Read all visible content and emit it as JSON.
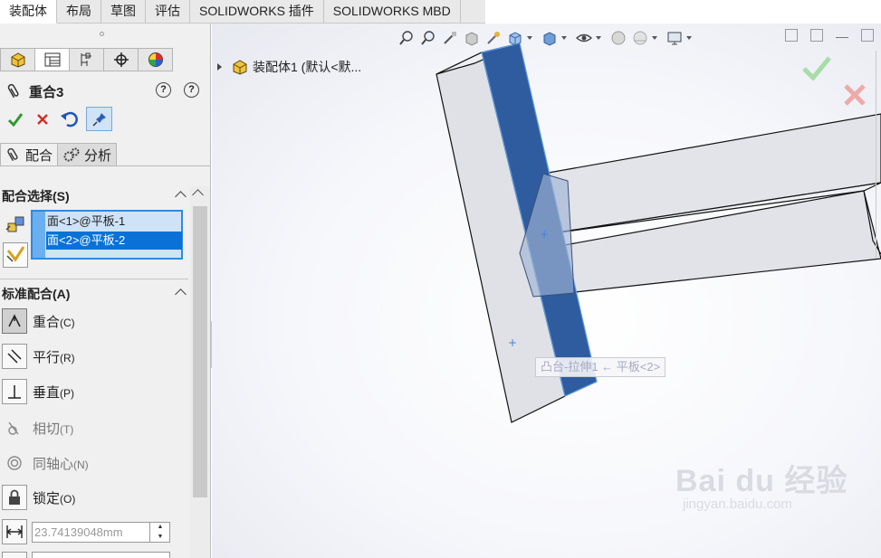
{
  "tabs": [
    {
      "label": "装配体",
      "active": true
    },
    {
      "label": "布局",
      "active": false
    },
    {
      "label": "草图",
      "active": false
    },
    {
      "label": "评估",
      "active": false
    },
    {
      "label": "SOLIDWORKS 插件",
      "active": false
    },
    {
      "label": "SOLIDWORKS MBD",
      "active": false
    }
  ],
  "property_manager": {
    "title": "重合3",
    "help_labels": [
      "?",
      "?"
    ],
    "subtabs": {
      "mates": "配合",
      "analysis": "分析"
    },
    "mate_selections": {
      "header": "配合选择(S)",
      "items": [
        {
          "text": "面<1>@平板-1",
          "selected": false
        },
        {
          "text": "面<2>@平板-2",
          "selected": true
        }
      ]
    },
    "standard_mates": {
      "header": "标准配合(A)",
      "items": [
        {
          "label": "重合",
          "hotkey": "(C)",
          "icon": "coincident-icon",
          "pressed": true,
          "enabled": true
        },
        {
          "label": "平行",
          "hotkey": "(R)",
          "icon": "parallel-icon",
          "pressed": false,
          "enabled": true
        },
        {
          "label": "垂直",
          "hotkey": "(P)",
          "icon": "perpendicular-icon",
          "pressed": false,
          "enabled": true
        },
        {
          "label": "相切",
          "hotkey": "(T)",
          "icon": "tangent-icon",
          "pressed": false,
          "enabled": false
        },
        {
          "label": "同轴心",
          "hotkey": "(N)",
          "icon": "concentric-icon",
          "pressed": false,
          "enabled": false
        },
        {
          "label": "锁定",
          "hotkey": "(O)",
          "icon": "lock-icon",
          "pressed": false,
          "enabled": true
        }
      ]
    },
    "distance_value": "23.74139048mm"
  },
  "viewport": {
    "tree_root": "装配体1  (默认<默...",
    "tooltip": "凸台-拉伸1 ← 平板<2>",
    "highlight_color": "#2f5c9e"
  },
  "watermark": {
    "brand": "Bai du 经验",
    "url": "jingyan.baidu.com"
  },
  "colors": {
    "accent": "#0a72d6",
    "ok": "#2e9a2e",
    "cancel": "#d0302a"
  }
}
